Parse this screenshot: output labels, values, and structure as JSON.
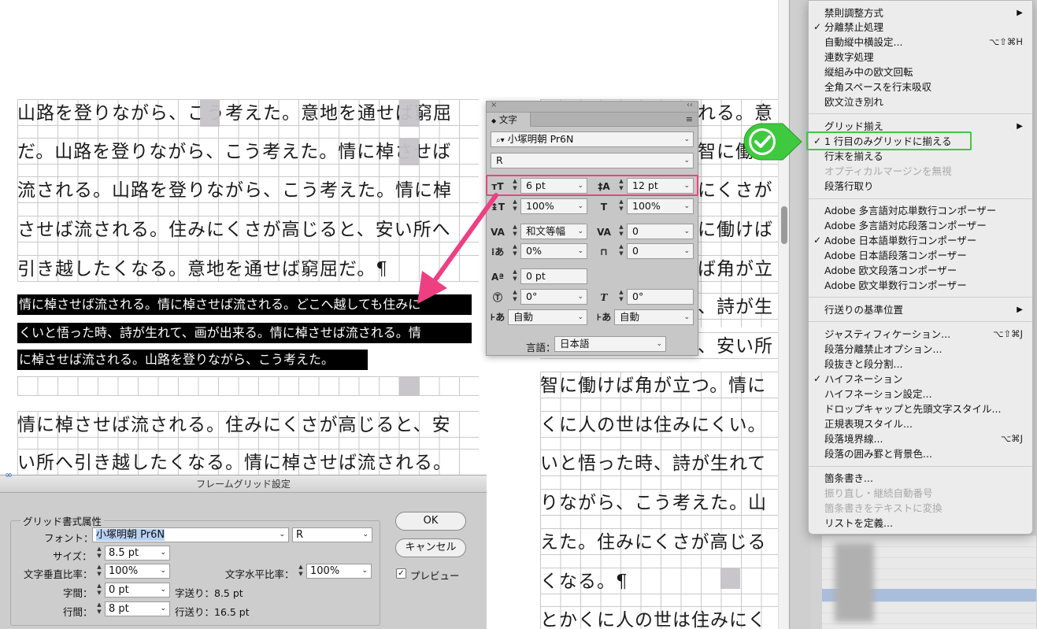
{
  "document": {
    "left_frame": [
      "山路を登りながら、こう考えた。意地を通せば窮屈",
      "だ。山路を登りながら、こう考えた。情に棹させば",
      "流される。山路を登りながら、こう考えた。情に棹",
      "させば流される。住みにくさが高じると、安い所へ",
      "引き越したくなる。意地を通せば窮屈だ。¶"
    ],
    "selected": [
      "情に棹させば流される。情に棹させば流される。どこへ越しても住みに",
      "くいと悟った時、詩が生れて、画が出来る。情に棹させば流される。情",
      "に棹させば流される。山路を登りながら、こう考えた。"
    ],
    "left_lower": [
      "情に棹させば流される。住みにくさが高じると、安",
      "い所へ引き越したくなる。情に棹させば流される。"
    ],
    "right_top": [
      "れる。意",
      "智に働",
      "にくさが",
      "に働けば",
      "ば角が立",
      "、詩が生",
      "、安い所"
    ],
    "right_frame": [
      "智に働けば角が立つ。情に",
      "くに人の世は住みにくい。",
      "いと悟った時、詩が生れて",
      "りながら、こう考えた。山",
      "えた。住みにくさが高じる",
      "くなる。¶",
      "とかくに人の世は住みにく"
    ]
  },
  "char_panel": {
    "tab": "文字",
    "font_family": "小塚明朝 Pr6N",
    "font_style": "R",
    "font_size": "6 pt",
    "leading": "12 pt",
    "vertical_scale": "100%",
    "horizontal_scale": "100%",
    "kerning": "和文等幅",
    "tracking": "0",
    "tsume": "0%",
    "aki": "0",
    "baseline_shift": "0 pt",
    "rotation": "0°",
    "skew": "0°",
    "aki_before": "自動",
    "aki_after": "自動",
    "language_label": "言語：",
    "language": "日本語"
  },
  "menu": {
    "items": [
      {
        "label": "禁則調整方式",
        "arrow": "▶"
      },
      {
        "label": "分離禁止処理",
        "check": "✓"
      },
      {
        "label": "自動縦中横設定...",
        "shortcut": "⌥⇧⌘H"
      },
      {
        "label": "連数字処理"
      },
      {
        "label": "縦組み中の欧文回転"
      },
      {
        "label": "全角スペースを行末吸収"
      },
      {
        "label": "欧文泣き別れ"
      },
      {
        "label": "グリッド揃え",
        "arrow": "▶"
      },
      {
        "label": "1 行目のみグリッドに揃える",
        "check": "✓"
      },
      {
        "label": "行末を揃える"
      },
      {
        "label": "オプティカルマージンを無視",
        "disabled": true
      },
      {
        "label": "段落行取り"
      },
      {
        "label": "Adobe 多言語対応単数行コンポーザー"
      },
      {
        "label": "Adobe 多言語対応段落コンポーザー"
      },
      {
        "label": "Adobe 日本語単数行コンポーザー",
        "check": "✓"
      },
      {
        "label": "Adobe 日本語段落コンポーザー"
      },
      {
        "label": "Adobe 欧文段落コンポーザー"
      },
      {
        "label": "Adobe 欧文単数行コンポーザー"
      },
      {
        "label": "行送りの基準位置",
        "arrow": "▶"
      },
      {
        "label": "ジャスティフィケーション...",
        "shortcut": "⌥⇧⌘J"
      },
      {
        "label": "段落分離禁止オプション..."
      },
      {
        "label": "段抜きと段分割..."
      },
      {
        "label": "ハイフネーション",
        "check": "✓"
      },
      {
        "label": "ハイフネーション設定..."
      },
      {
        "label": "ドロップキャップと先頭文字スタイル..."
      },
      {
        "label": "正規表現スタイル..."
      },
      {
        "label": "段落境界線...",
        "shortcut": "⌥⌘J"
      },
      {
        "label": "段落の囲み罫と背景色..."
      },
      {
        "label": "箇条書き..."
      },
      {
        "label": "振り直し・継続自動番号",
        "disabled": true
      },
      {
        "label": "箇条書きをテキストに変換",
        "disabled": true
      },
      {
        "label": "リストを定義..."
      }
    ]
  },
  "dialog": {
    "title": "フレームグリッド設定",
    "group_label": "グリッド書式属性",
    "font_label": "フォント：",
    "font_value": "小塚明朝 Pr6N",
    "font_style": "R",
    "size_label": "サイズ：",
    "size_value": "8.5 pt",
    "vscale_label": "文字垂直比率：",
    "vscale_value": "100%",
    "hscale_label": "文字水平比率：",
    "hscale_value": "100%",
    "spacing_label": "字間：",
    "spacing_value": "0 pt",
    "char_pitch": "字送り：8.5 pt",
    "line_label": "行間：",
    "line_value": "8 pt",
    "line_pitch": "行送り：16.5 pt",
    "ok": "OK",
    "cancel": "キャンセル",
    "preview": "プレビュー"
  },
  "colors": {
    "highlight_pink": "#e8457e",
    "highlight_green": "#3ec93e",
    "selection": "#000000"
  }
}
